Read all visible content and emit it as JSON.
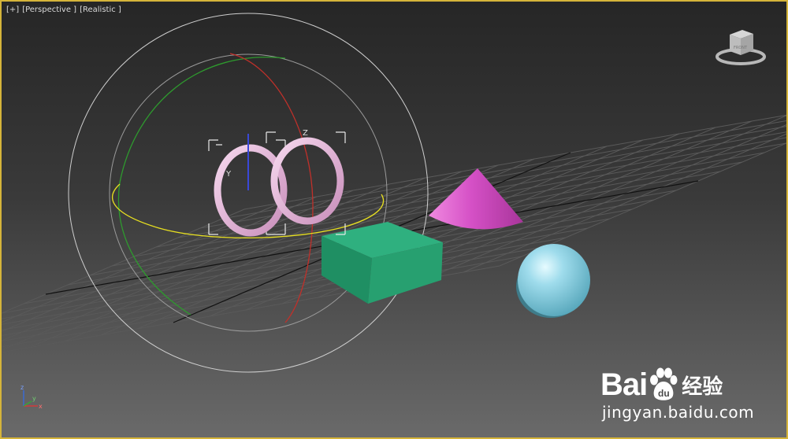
{
  "viewport": {
    "labels": [
      "[+]",
      "[Perspective ]",
      "[Realistic ]"
    ],
    "border_color": "#d5b43a",
    "background_top": "#262626",
    "background_bottom": "#6a6a6a"
  },
  "scene": {
    "objects": [
      {
        "name": "torus-1",
        "color": "#e8b4dc",
        "selected": true,
        "gizmo_axis_label": "Y"
      },
      {
        "name": "torus-2",
        "color": "#e8b4dc",
        "selected": true,
        "gizmo_axis_label": "Z"
      },
      {
        "name": "box",
        "color": "#2aa77a"
      },
      {
        "name": "cone",
        "color": "#d64fc4"
      },
      {
        "name": "sphere",
        "color": "#8fd4e6"
      }
    ],
    "rotate_gizmo": {
      "colors": {
        "x": "#c0302a",
        "y": "#2e9a2e",
        "z": "#e8e020",
        "view": "#cfcfcf"
      }
    },
    "grid_color": "#5a5a5a",
    "home_grid_axis_color": "#111111"
  },
  "viewcube": {
    "icon": "viewcube-icon",
    "label": "FRONT"
  },
  "axis_tripod": {
    "labels": [
      "z",
      "x",
      "y"
    ],
    "colors": {
      "x": "#d23a3a",
      "y": "#3aa33a",
      "z": "#3a6ad2"
    }
  },
  "watermark": {
    "bai": "Bai",
    "du": "du",
    "product": "经验",
    "url": "jingyan.baidu.com",
    "icon": "paw-icon"
  }
}
